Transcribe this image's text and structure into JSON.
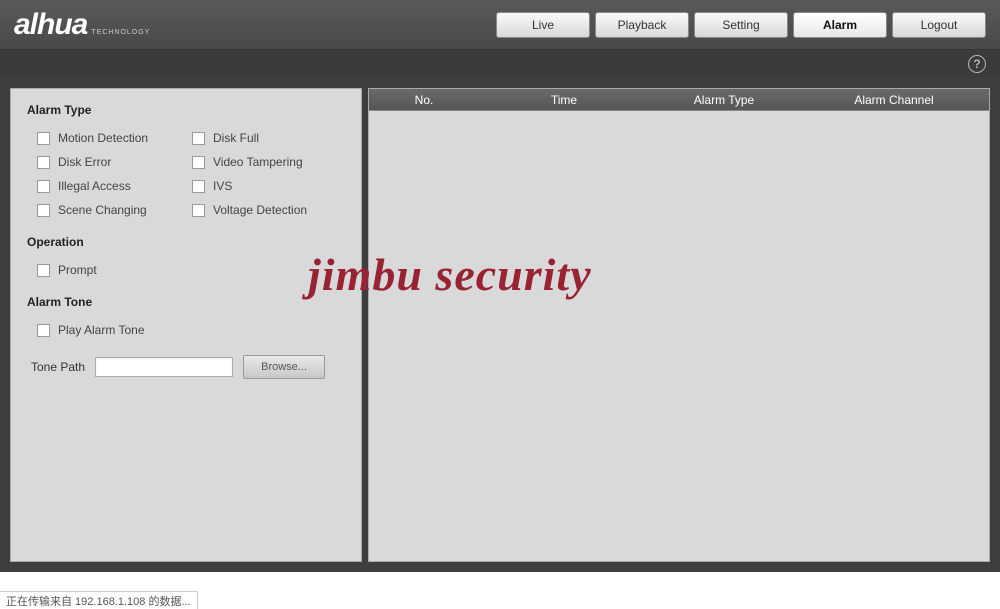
{
  "brand": {
    "name": "alhua",
    "sub": "TECHNOLOGY"
  },
  "nav": {
    "live": "Live",
    "playback": "Playback",
    "setting": "Setting",
    "alarm": "Alarm",
    "logout": "Logout",
    "active": "alarm"
  },
  "help_glyph": "?",
  "sections": {
    "alarm_type": "Alarm Type",
    "operation": "Operation",
    "alarm_tone": "Alarm Tone"
  },
  "checks": {
    "motion": "Motion Detection",
    "disk_full": "Disk Full",
    "disk_error": "Disk Error",
    "video_tampering": "Video Tampering",
    "illegal_access": "Illegal Access",
    "ivs": "IVS",
    "scene_changing": "Scene Changing",
    "voltage_detection": "Voltage Detection",
    "prompt": "Prompt",
    "play_tone": "Play Alarm Tone"
  },
  "tone": {
    "label": "Tone Path",
    "value": "",
    "browse": "Browse..."
  },
  "table": {
    "no": "No.",
    "time": "Time",
    "type": "Alarm Type",
    "channel": "Alarm Channel"
  },
  "watermark": "jimbu security",
  "footer": "正在传输来自 192.168.1.108 的数据..."
}
